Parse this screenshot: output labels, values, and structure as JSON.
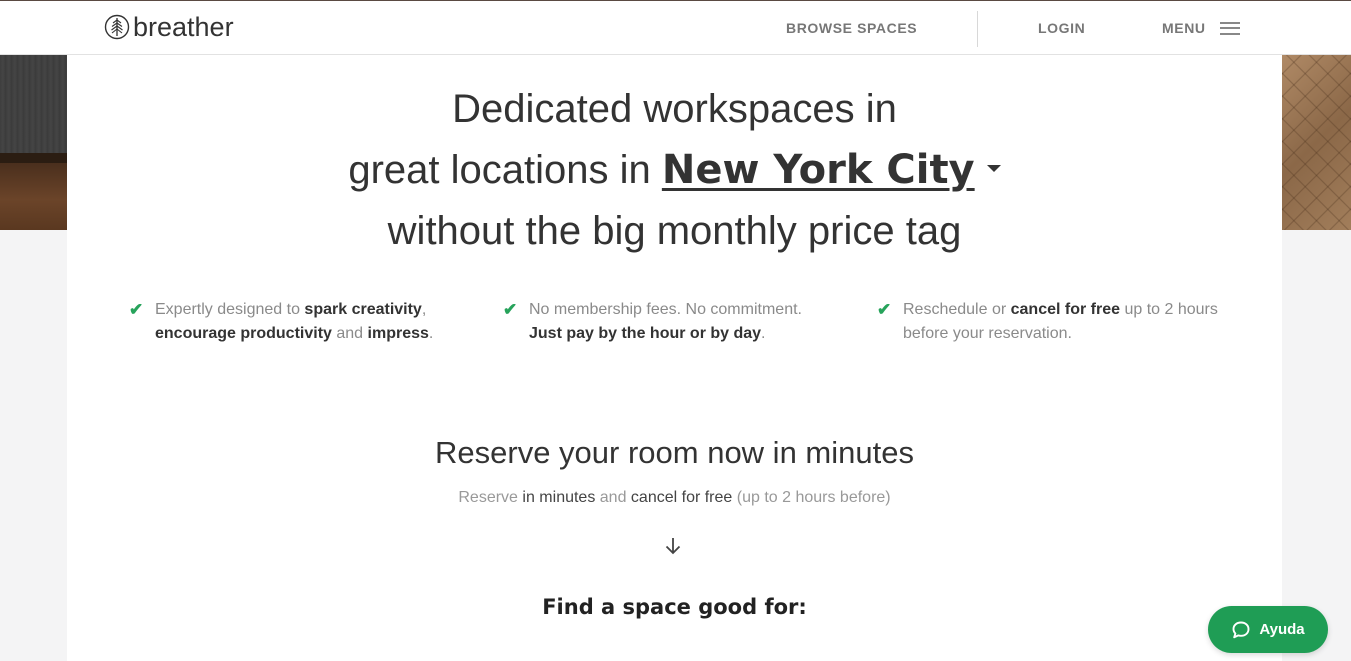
{
  "header": {
    "logo_text": "breather",
    "nav": {
      "browse": "BROWSE SPACES",
      "login": "LOGIN",
      "menu": "MENU"
    }
  },
  "hero": {
    "line1": "Dedicated workspaces in",
    "line2_prefix": "great locations in ",
    "city": "New York City",
    "line3": "without the big monthly price tag"
  },
  "features": [
    {
      "parts": [
        {
          "t": "Expertly designed to ",
          "b": false
        },
        {
          "t": "spark creativity",
          "b": true
        },
        {
          "t": ", ",
          "b": false
        },
        {
          "t": "encourage productivity",
          "b": true
        },
        {
          "t": " and ",
          "b": false
        },
        {
          "t": "impress",
          "b": true
        },
        {
          "t": ".",
          "b": false
        }
      ]
    },
    {
      "parts": [
        {
          "t": "No membership fees. No commitment. ",
          "b": false
        },
        {
          "t": "Just pay by the hour or by day",
          "b": true
        },
        {
          "t": ".",
          "b": false
        }
      ]
    },
    {
      "parts": [
        {
          "t": "Reschedule or ",
          "b": false
        },
        {
          "t": "cancel for free",
          "b": true
        },
        {
          "t": " up to 2 hours before your reservation.",
          "b": false
        }
      ]
    }
  ],
  "reserve": {
    "title": "Reserve your room now in minutes",
    "sub": {
      "p1": "Reserve ",
      "p2": "in minutes",
      "p3": " and ",
      "p4": "cancel for free",
      "p5": " (up to 2 hours before)"
    }
  },
  "find": {
    "title": "Find a space good for:"
  },
  "help": {
    "label": "Ayuda"
  },
  "colors": {
    "accent_green": "#1f9d55",
    "check_green": "#27a35b"
  }
}
